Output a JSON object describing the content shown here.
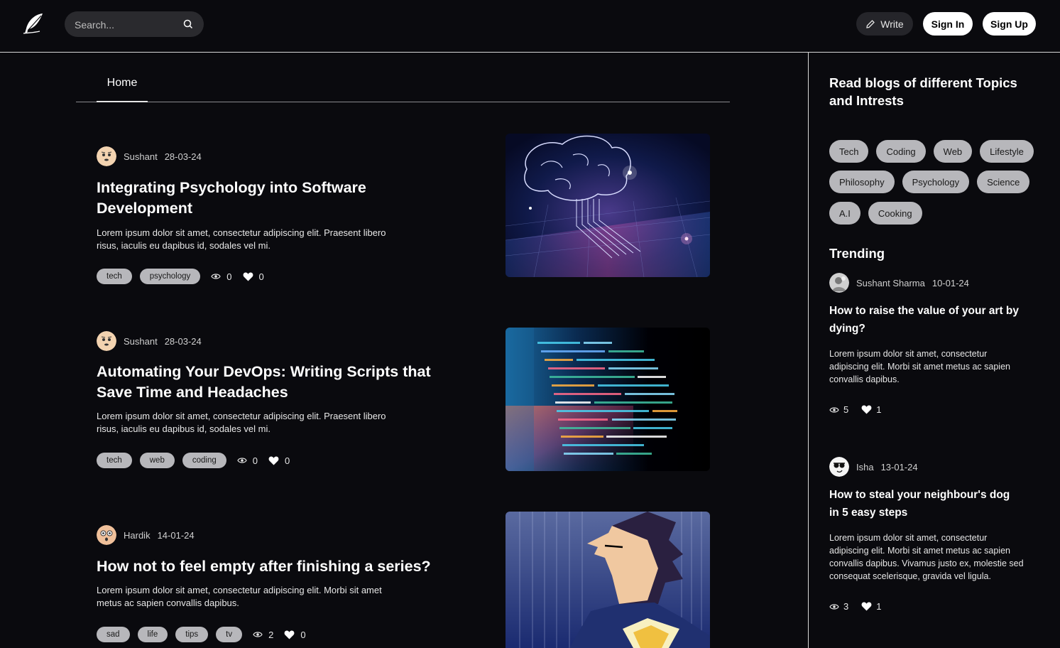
{
  "header": {
    "search_placeholder": "Search...",
    "write_label": "Write",
    "signin_label": "Sign In",
    "signup_label": "Sign Up"
  },
  "tabs": {
    "home": "Home"
  },
  "posts": [
    {
      "author": "Sushant",
      "date": "28-03-24",
      "title": "Integrating Psychology into Software Development",
      "excerpt": "Lorem ipsum dolor sit amet, consectetur adipiscing elit. Praesent libero risus, iaculis eu dapibus id, sodales vel mi.",
      "tags": [
        "tech",
        "psychology"
      ],
      "views": "0",
      "likes": "0"
    },
    {
      "author": "Sushant",
      "date": "28-03-24",
      "title": "Automating Your DevOps: Writing Scripts that Save Time and Headaches",
      "excerpt": "Lorem ipsum dolor sit amet, consectetur adipiscing elit. Praesent libero risus, iaculis eu dapibus id, sodales vel mi.",
      "tags": [
        "tech",
        "web",
        "coding"
      ],
      "views": "0",
      "likes": "0"
    },
    {
      "author": "Hardik",
      "date": "14-01-24",
      "title": "How not to feel empty after finishing a series?",
      "excerpt": "Lorem ipsum dolor sit amet, consectetur adipiscing elit. Morbi sit amet metus ac sapien convallis dapibus.",
      "tags": [
        "sad",
        "life",
        "tips",
        "tv"
      ],
      "views": "2",
      "likes": "0"
    }
  ],
  "sidebar": {
    "heading": "Read blogs of different Topics and Intrests",
    "topics": [
      "Tech",
      "Coding",
      "Web",
      "Lifestyle",
      "Philosophy",
      "Psychology",
      "Science",
      "A.I",
      "Cooking"
    ],
    "trending_title": "Trending",
    "trending": [
      {
        "author": "Sushant Sharma",
        "date": "10-01-24",
        "title": "How to raise the value of your art by dying?",
        "excerpt": "Lorem ipsum dolor sit amet, consectetur adipiscing elit. Morbi sit amet metus ac sapien convallis dapibus.",
        "views": "5",
        "likes": "1"
      },
      {
        "author": "Isha",
        "date": "13-01-24",
        "title": "How to steal your neighbour's dog in 5 easy steps",
        "excerpt": "Lorem ipsum dolor sit amet, consectetur adipiscing elit. Morbi sit amet metus ac sapien convallis dapibus. Vivamus justo ex, molestie sed consequat scelerisque, gravida vel ligula.",
        "views": "3",
        "likes": "1"
      }
    ]
  },
  "colors": {
    "background": "#0a0a0e",
    "tag_bg": "#b7b7bb",
    "search_bg": "#2a2a2e",
    "button_bg": "#ffffff"
  }
}
